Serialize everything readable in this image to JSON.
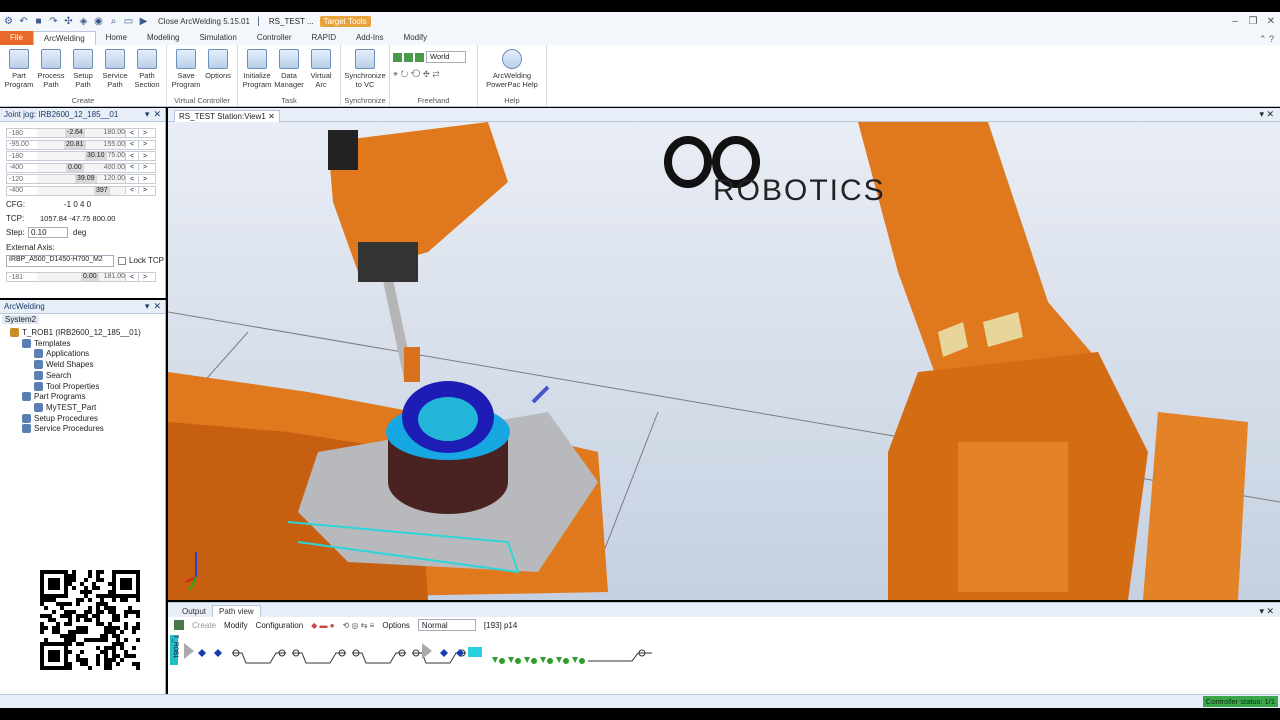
{
  "titlebar": {
    "title": "Close ArcWelding 5.15.01",
    "station": "RS_TEST ...",
    "context_tab": "Target Tools"
  },
  "tabs": [
    "File",
    "ArcWelding",
    "Home",
    "Modeling",
    "Simulation",
    "Controller",
    "RAPID",
    "Add-Ins",
    "Modify"
  ],
  "ribbon": {
    "create": {
      "label": "Create",
      "buttons": [
        "Part Program",
        "Process Path",
        "Setup Path",
        "Service Path",
        "Path Section"
      ]
    },
    "vc": {
      "label": "Virtual Controller",
      "buttons": [
        "Save Program",
        "Options"
      ]
    },
    "task": {
      "label": "Task",
      "buttons": [
        "Initialize Program",
        "Data Manager",
        "Virtual Arc"
      ]
    },
    "sync": {
      "label": "Synchronize",
      "buttons": [
        "Synchronize to VC"
      ]
    },
    "freehand": {
      "label": "Freehand",
      "world": "World"
    },
    "help": {
      "label": "Help",
      "buttons": [
        "ArcWelding PowerPac Help"
      ]
    }
  },
  "jog": {
    "title": "Joint jog: IRB2600_12_185__01",
    "rows": [
      {
        "min": "-180",
        "val": "-2.64",
        "max": "180.00",
        "fill": 0.49
      },
      {
        "min": "-95.00",
        "val": "20.81",
        "max": "155.00",
        "fill": 0.46
      },
      {
        "min": "-180",
        "val": "30.10",
        "max": "75.00",
        "fill": 0.82
      },
      {
        "min": "-400",
        "val": "0.00",
        "max": "400.00",
        "fill": 0.5
      },
      {
        "min": "-120",
        "val": "39.09",
        "max": "120.00",
        "fill": 0.66
      },
      {
        "min": "-400",
        "val": "397",
        "max": "",
        "fill": 0.99
      }
    ],
    "cfg_label": "CFG:",
    "cfg": "-1 0 4 0",
    "tcp_label": "TCP:",
    "tcp": "1057.84 -47.75 800.00",
    "step_label": "Step:",
    "step": "0.10",
    "step_unit": "deg",
    "ext_label": "External Axis:",
    "ext_value": "IRBP_A500_D1450-H700_M2",
    "lock_tcp": "Lock TCP",
    "ext_row": {
      "min": "-181",
      "val": "0.00",
      "max": "181.00"
    }
  },
  "arc": {
    "title": "ArcWelding",
    "system": "System2",
    "tree": [
      "T_ROB1 (IRB2600_12_185__01)",
      "Templates",
      "Applications",
      "Weld Shapes",
      "Search",
      "Tool Properties",
      "Part Programs",
      "MyTEST_Part",
      "Setup Procedures",
      "Service Procedures"
    ]
  },
  "view": {
    "tab": "RS_TEST Station:View1",
    "logo": "ROBOTICS"
  },
  "bottom": {
    "tabs": [
      "Output",
      "Path view"
    ],
    "toolbar": [
      "Create",
      "Modify",
      "Configuration",
      "Options"
    ],
    "mode": "Normal",
    "status": "[193] p14",
    "track": "T_ROB1"
  },
  "statusbar": {
    "controller": "Controller status: 1/1"
  }
}
